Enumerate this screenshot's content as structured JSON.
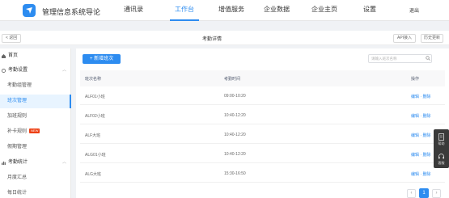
{
  "brand": "管理信息系统导论",
  "nav": [
    {
      "label": "通讯录",
      "active": false
    },
    {
      "label": "工作台",
      "active": true
    },
    {
      "label": "增值服务",
      "active": false
    },
    {
      "label": "企业数据",
      "active": false
    },
    {
      "label": "企业主页",
      "active": false
    },
    {
      "label": "设置",
      "active": false
    }
  ],
  "logout_label": "退出",
  "subheader": {
    "back_label": "< 返回",
    "title": "考勤详情",
    "api_label": "API接入",
    "history_label": "历史更新"
  },
  "sidebar": {
    "items": [
      {
        "label": "首页"
      },
      {
        "label": "考勤设置"
      },
      {
        "label": "考勤组管理"
      },
      {
        "label": "班次管理"
      },
      {
        "label": "加班规则"
      },
      {
        "label": "补卡规则",
        "badge": "NEW"
      },
      {
        "label": "假期管理"
      },
      {
        "label": "考勤统计"
      },
      {
        "label": "月度汇总"
      },
      {
        "label": "每日统计"
      }
    ]
  },
  "main": {
    "add_button": "+ 新增班次",
    "search_placeholder": "请输入班次名称",
    "columns": [
      "班次名称",
      "考勤时间",
      "操作"
    ],
    "rows": [
      {
        "name": "ALF01小班",
        "time": "09:00-10:20",
        "action": "编辑 · 删除"
      },
      {
        "name": "ALF02小班",
        "time": "10:40-12:20",
        "action": "编辑 · 删除"
      },
      {
        "name": "ALF大班",
        "time": "10:40-12:20",
        "action": "编辑 · 删除"
      },
      {
        "name": "ALG01小班",
        "time": "10:40-12:20",
        "action": "编辑 · 删除"
      },
      {
        "name": "ALG大班",
        "time": "15:30-16:50",
        "action": "编辑 · 删除"
      }
    ],
    "pagination": {
      "prev": "‹",
      "current": "1",
      "next": "›"
    }
  },
  "float_tools": [
    {
      "label": "帮助",
      "icon": "document-icon"
    },
    {
      "label": "客服",
      "icon": "headset-icon"
    }
  ],
  "colors": {
    "accent": "#2d8cf0",
    "badge": "#ed4014",
    "float_panel": "#3a3a3a"
  }
}
